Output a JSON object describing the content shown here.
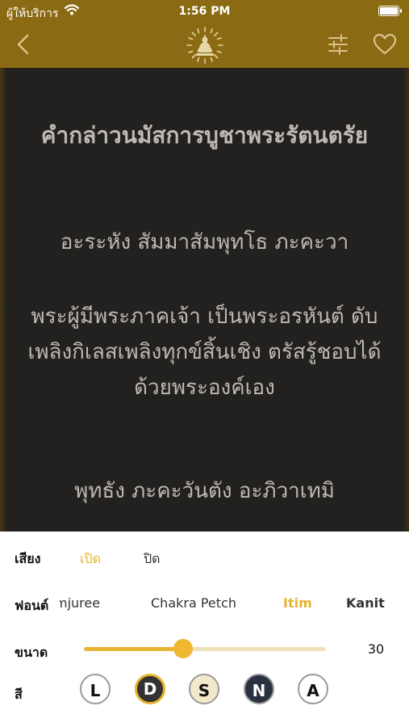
{
  "status_bar": {
    "carrier": "ผู้ให้บริการ",
    "time": "1:56 PM"
  },
  "nav": {
    "back_icon": "chevron-left-icon",
    "logo_icon": "buddha-logo-icon",
    "settings_icon": "sliders-icon",
    "favorite_icon": "heart-icon"
  },
  "content": {
    "title": "คำกล่าวนมัสการบูชาพระรัตนตรัย",
    "verse1": "อะระหัง สัมมาสัมพุทโธ ภะคะวา",
    "verse2": "พระผู้มีพระภาคเจ้า เป็นพระอรหันต์ ดับเพลิงกิเลสเพลิงทุกข์สิ้นเชิง ตรัสรู้ชอบได้ด้วยพระองค์เอง",
    "verse3": "พุทธัง ภะคะวันตัง อะภิวาเทมิ"
  },
  "settings": {
    "sound_label": "เสียง",
    "sound_on": "เปิด",
    "sound_off": "ปิด",
    "sound_selected": "เปิด",
    "font_label": "ฟอนต์",
    "fonts": [
      "mjuree",
      "Chakra Petch",
      "Itim",
      "Kanit"
    ],
    "font_selected": "Itim",
    "size_label": "ขนาด",
    "size_value": "30",
    "size_fraction": 0.41,
    "color_label": "สี",
    "themes": [
      "L",
      "D",
      "S",
      "N",
      "A"
    ],
    "theme_selected": "D"
  },
  "colors": {
    "header": "#8a6a12",
    "accent": "#e7b32a",
    "text": "#bdbab4"
  }
}
